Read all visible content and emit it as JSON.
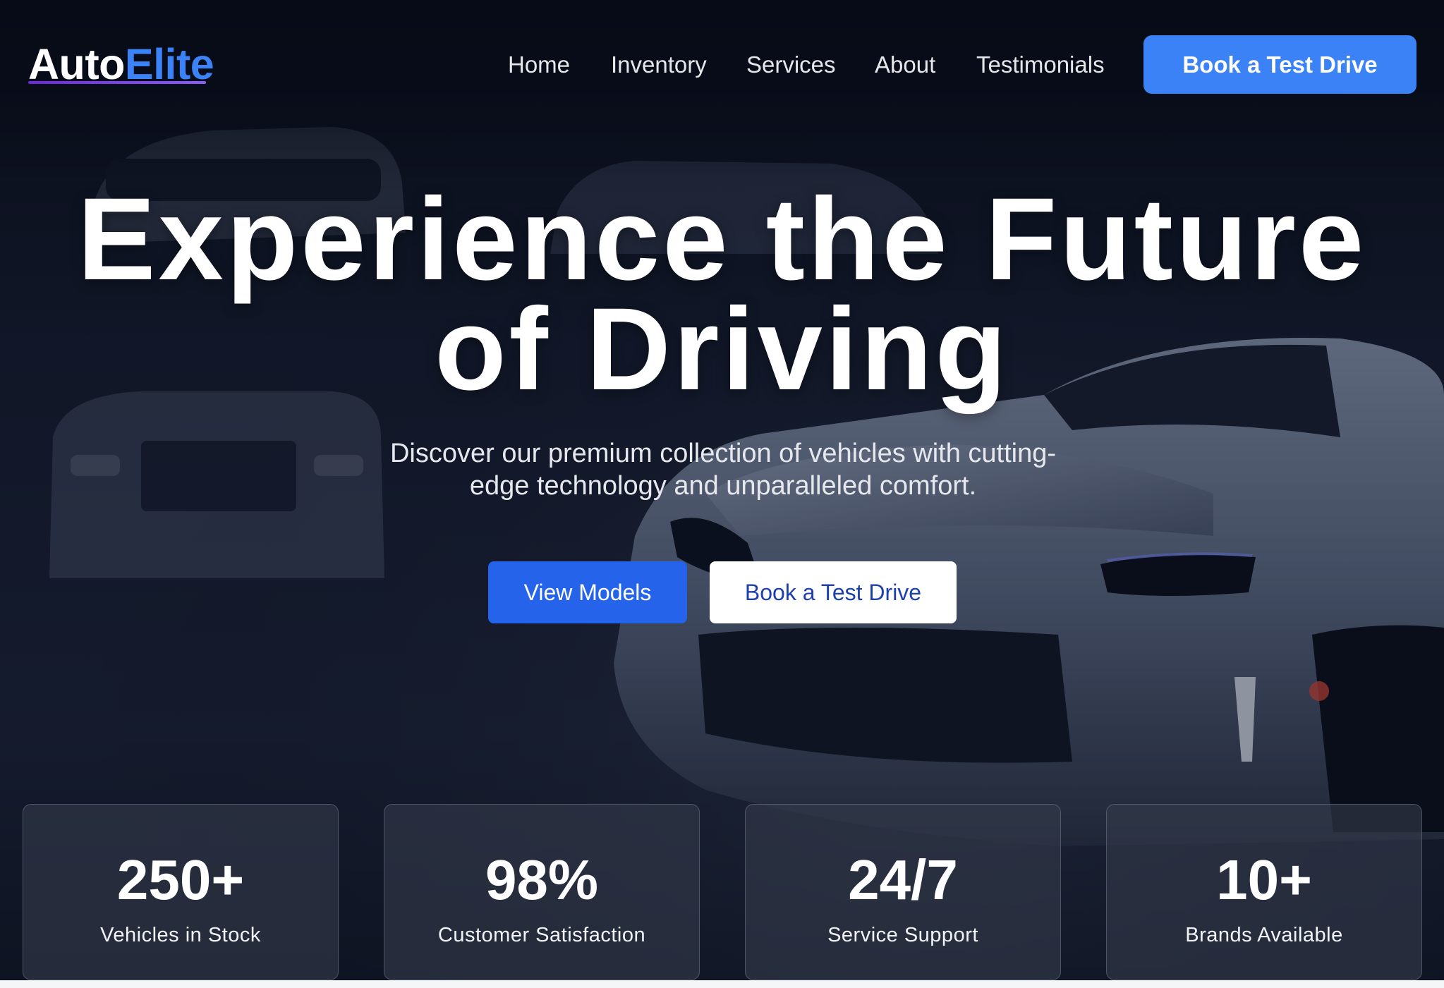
{
  "brand": {
    "logo_part_a": "Auto",
    "logo_part_b": "Elite",
    "accent_color": "#3b82f6",
    "underline_color": "#7c3aed"
  },
  "nav": {
    "items": [
      {
        "label": "Home"
      },
      {
        "label": "Inventory"
      },
      {
        "label": "Services"
      },
      {
        "label": "About"
      },
      {
        "label": "Testimonials"
      }
    ],
    "cta_label": "Book a Test Drive"
  },
  "hero": {
    "title_line_1": "Experience the Future",
    "title_line_2": "of Driving",
    "subtitle_line_1": "Discover our premium collection of vehicles with cutting-",
    "subtitle_line_2": "edge technology and unparalleled comfort.",
    "primary_button": "View Models",
    "secondary_button": "Book a Test Drive",
    "background_image": "car-showroom-image"
  },
  "stats": [
    {
      "value": "250+",
      "label": "Vehicles in Stock"
    },
    {
      "value": "98%",
      "label": "Customer Satisfaction"
    },
    {
      "value": "24/7",
      "label": "Service Support"
    },
    {
      "value": "10+",
      "label": "Brands Available"
    }
  ],
  "colors": {
    "primary_button": "#2563eb",
    "background_dark": "#0d1222",
    "secondary_button_text": "#1e40af"
  }
}
